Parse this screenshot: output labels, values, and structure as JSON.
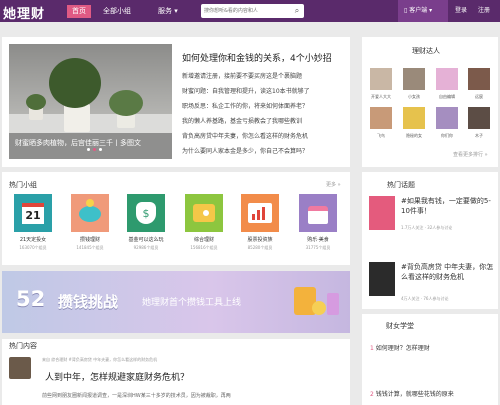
{
  "header": {
    "logo": "她理财",
    "nav": [
      "首页",
      "全部小组",
      "服务"
    ],
    "services_arrow": "▾",
    "search_placeholder": "搜你想听&看的内容和人",
    "client": "客户端",
    "client_arrow": "▾",
    "login": "登录",
    "register": "注册"
  },
  "featured": {
    "caption": "财蜜晒多肉植物，后宫佳丽三千丨多图文",
    "title": "如何处理你和金钱的关系，4个小妙招",
    "articles": [
      "新增邀请注册，接前要不要买房这是个裹脑题",
      "财蜜问题：自我管理和提升，读这10本书就够了",
      "职场反思：私企工作的你，将来如何体面养老？",
      "我的懒人养基路，基金亏损教会了我哪些教训",
      "背负高房贷中年夫妻，你怎么看这样的财务危机",
      "为什么要同人家本金是多少，你自己不会算吗？"
    ]
  },
  "groups": {
    "title": "热门小组",
    "more": "更多 »",
    "items": [
      {
        "name": "21天定投女",
        "count": "163070个组员"
      },
      {
        "name": "攒钱理财",
        "count": "141845个组员"
      },
      {
        "name": "基金可以这么玩",
        "count": "92986个组员"
      },
      {
        "name": "综合理财",
        "count": "156816个组员"
      },
      {
        "name": "股票投资族",
        "count": "85280个组员"
      },
      {
        "name": "购乐·美食",
        "count": "31775个组员"
      }
    ]
  },
  "banner": {
    "number": "52",
    "title": "攒钱挑战",
    "subtitle": "她理财首个攒钱工具上线"
  },
  "hot_content": {
    "title": "热门内容",
    "meta": "来自 综合理财 #背负高房贷 中年夫妻，你怎么看这样的财务危机",
    "post_title": "人到中年，怎样规避家庭财务危机？",
    "excerpt": "前些网到朋友圈新闻报道调查，一是深圳HW某三十多岁的技术员，因为被裁职，再两"
  },
  "experts": {
    "title": "理财达人",
    "people": [
      "开爱人大大",
      "小女孩",
      "自由编辑",
      "远宸",
      "飞鸟",
      "隐秘的女",
      "你们你",
      "木子"
    ],
    "more": "查看更多排行 »"
  },
  "topics": {
    "title": "热门话题",
    "items": [
      {
        "text": "#如果我有钱，一定要做的5-10件事！",
        "meta": "1.7万人关注 · 32人参与讨论"
      },
      {
        "text": "#背负高房贷 中年夫妻，你怎么看这样的财务危机",
        "meta": "4万人关注 · 76人参与讨论"
      }
    ]
  },
  "school": {
    "title": "财女学堂",
    "items": [
      "如何理财？怎样理财",
      "钱钱计算，就哪些花钱的原来"
    ]
  }
}
